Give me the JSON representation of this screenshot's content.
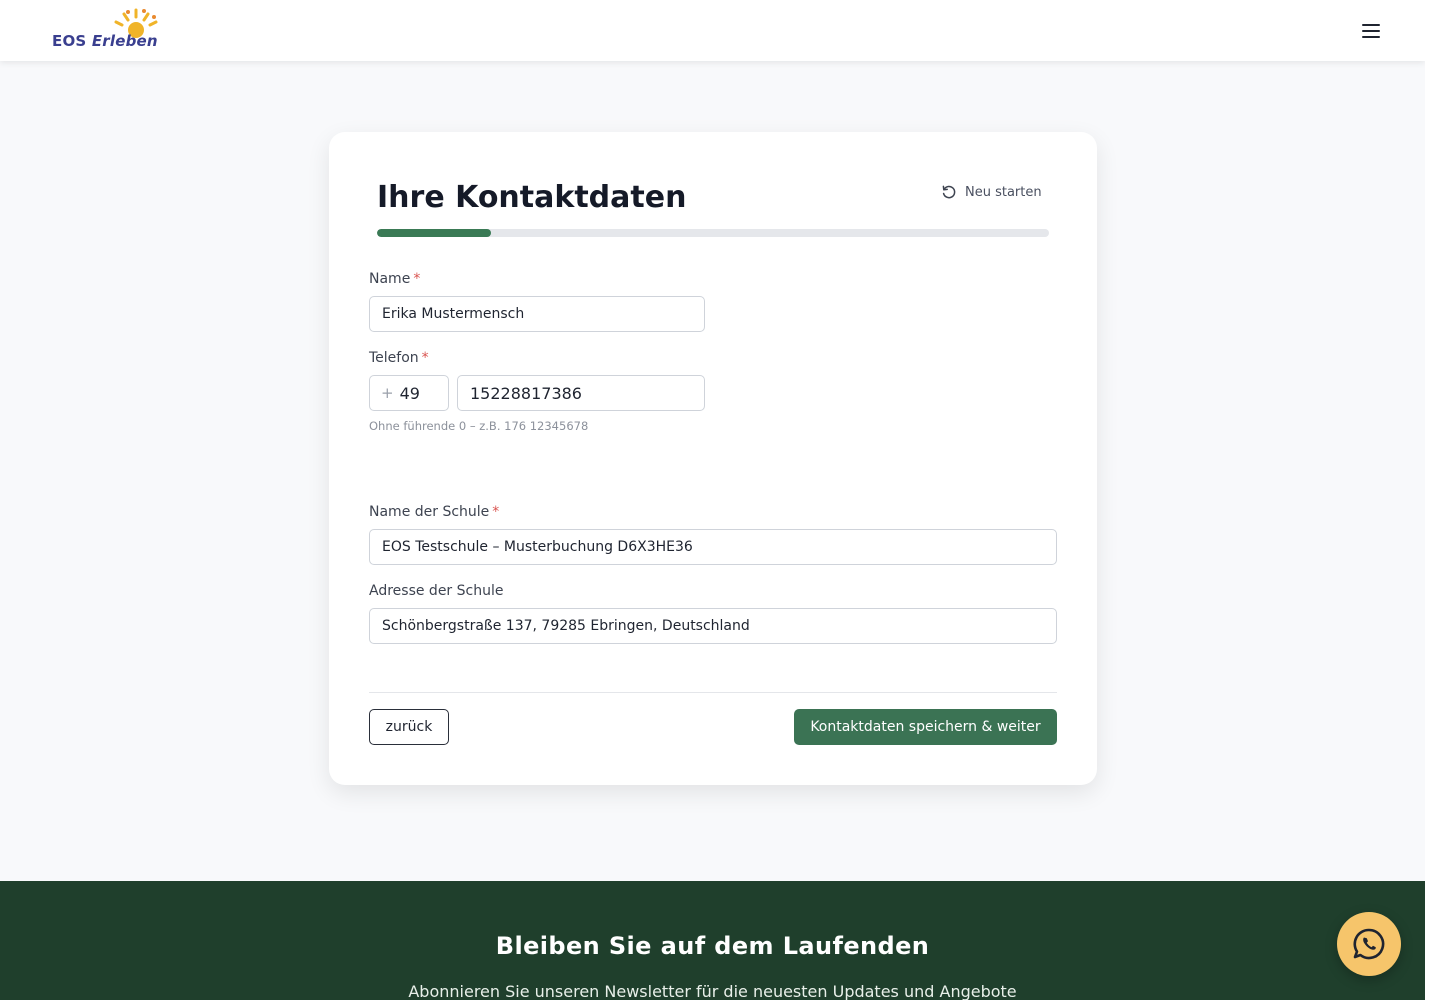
{
  "header": {
    "logo_word1": "EOS",
    "logo_word2": "Erleben",
    "brand_colors": {
      "logo_blue": "#3a3f8f",
      "sun": "#f0b429"
    },
    "menu_icon": "hamburger-icon"
  },
  "form": {
    "title": "Ihre Kontaktdaten",
    "restart_label": "Neu starten",
    "restart_icon": "refresh-icon",
    "progress_fraction": 0.17,
    "accent_color": "#3b7354",
    "required_marker": "*",
    "fields": {
      "name": {
        "label": "Name",
        "value": "Erika Mustermensch"
      },
      "phone": {
        "label": "Telefon",
        "prefix_symbol": "+",
        "country_code": "49",
        "value": "15228817386",
        "hint": "Ohne führende 0 – z.B. 176 12345678"
      },
      "school_name": {
        "label": "Name der Schule",
        "value": "EOS Testschule – Musterbuchung D6X3HE36"
      },
      "school_address": {
        "label": "Adresse der Schule",
        "value": "Schönbergstraße 137, 79285 Ebringen, Deutschland"
      }
    },
    "back_label": "zurück",
    "submit_label": "Kontaktdaten speichern & weiter"
  },
  "footer": {
    "title": "Bleiben Sie auf dem Laufenden",
    "subtitle": "Abonnieren Sie unseren Newsletter für die neuesten Updates und Angebote",
    "background_color": "#1f3f2c"
  },
  "floating": {
    "whatsapp_icon": "whatsapp-icon",
    "whatsapp_color": "#f6c56b"
  }
}
